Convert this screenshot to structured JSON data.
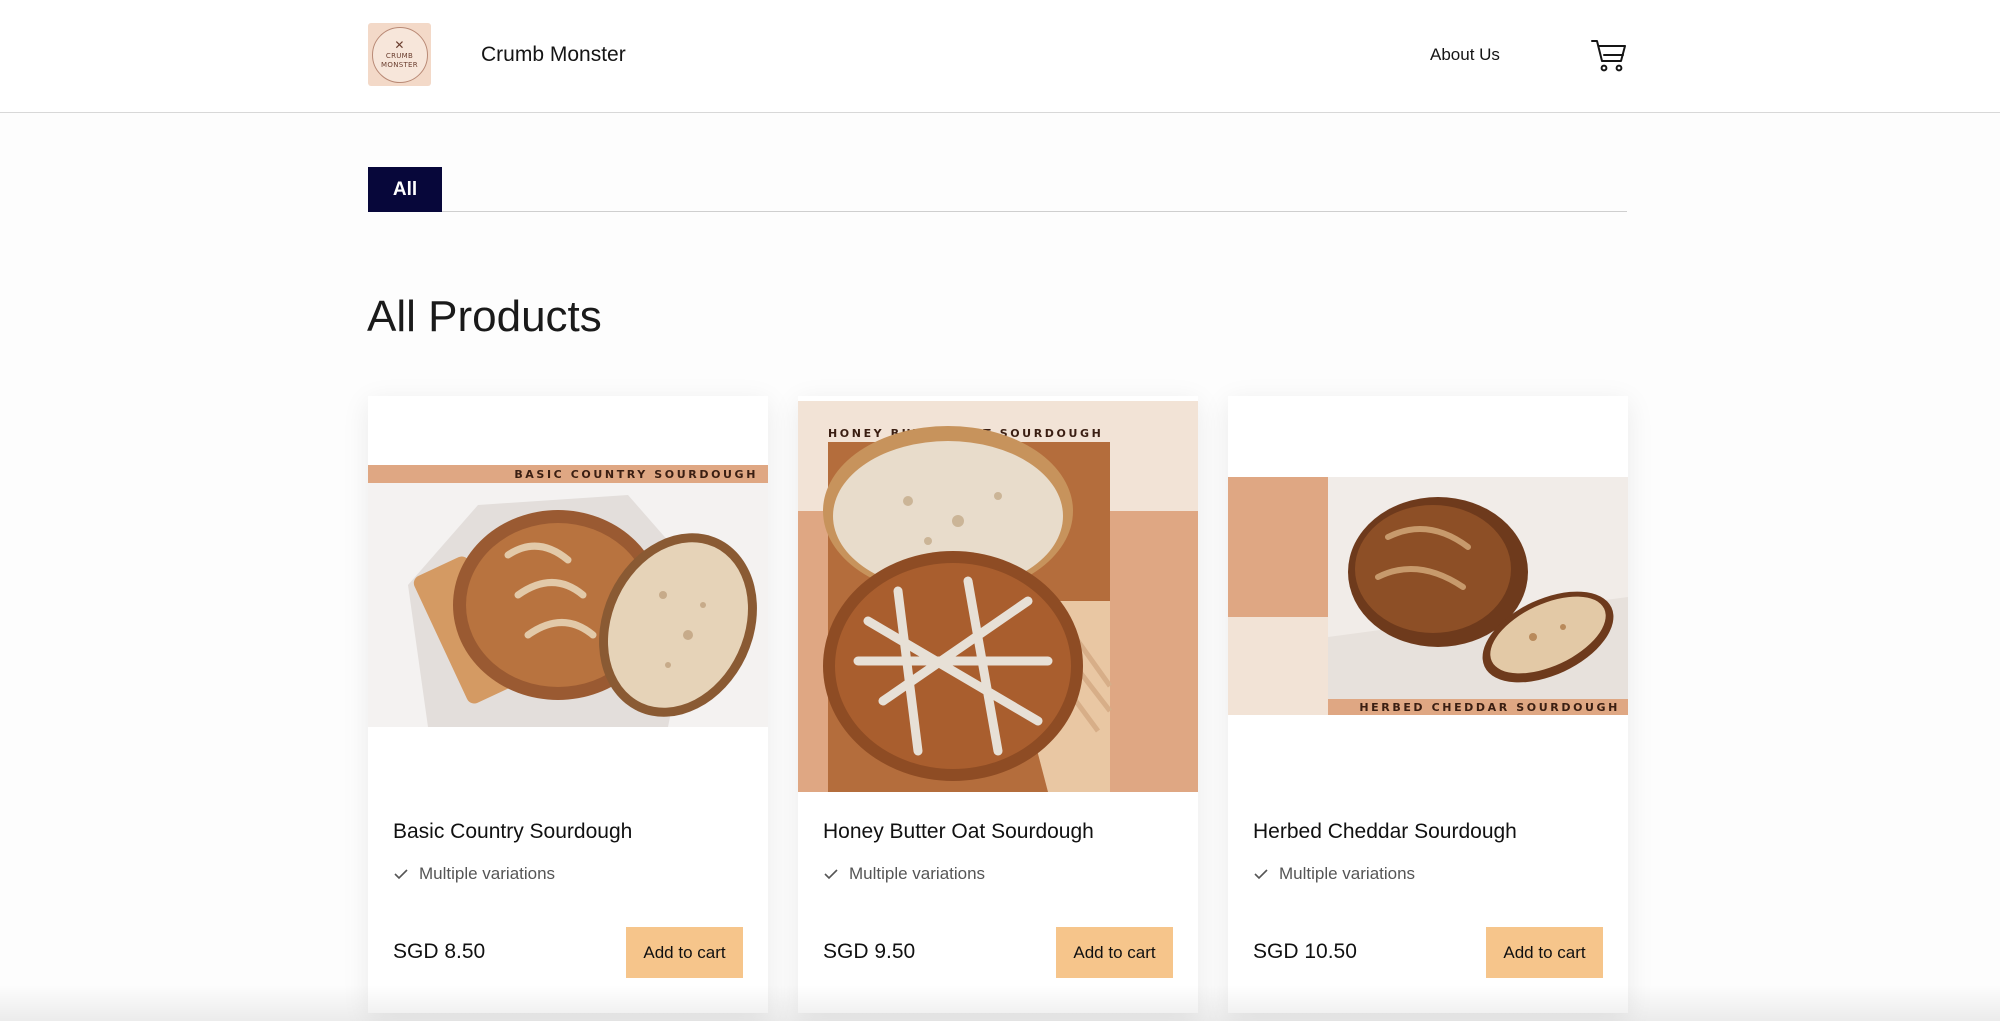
{
  "header": {
    "brand": "Crumb Monster",
    "logo_text": [
      "CRUMB",
      "MONSTER"
    ],
    "nav_about": "About Us",
    "cart_icon": "cart-icon"
  },
  "tabs": [
    {
      "label": "All",
      "active": true
    }
  ],
  "page_title": "All Products",
  "products": [
    {
      "name": "Basic Country Sourdough",
      "variation_note": "Multiple variations",
      "price": "SGD 8.50",
      "button": "Add to cart",
      "image_label": "BASIC COUNTRY SOURDOUGH"
    },
    {
      "name": "Honey Butter Oat Sourdough",
      "variation_note": "Multiple variations",
      "price": "SGD 9.50",
      "button": "Add to cart",
      "image_label": "HONEY BUTTER OAT SOURDOUGH"
    },
    {
      "name": "Herbed Cheddar Sourdough",
      "variation_note": "Multiple variations",
      "price": "SGD 10.50",
      "button": "Add to cart",
      "image_label": "HERBED CHEDDAR SOURDOUGH"
    }
  ],
  "colors": {
    "tab_active_bg": "#07073a",
    "button_bg": "#f6c58b",
    "image_peach": "#dfa783",
    "image_cream": "#f2e3d6"
  }
}
